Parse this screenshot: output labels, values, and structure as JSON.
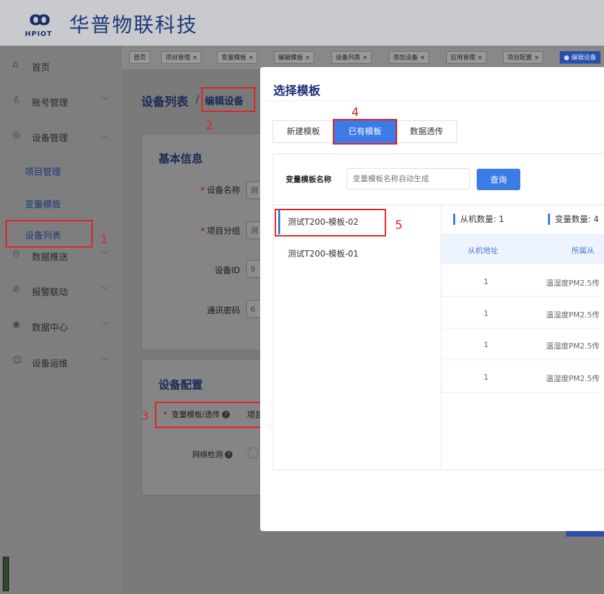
{
  "header": {
    "brand": "华普物联科技",
    "logo_text": "HPIOT"
  },
  "sidebar": {
    "items": [
      {
        "label": "首页",
        "icon": "home-icon",
        "glyph": "⌂"
      },
      {
        "label": "账号管理",
        "icon": "user-icon",
        "glyph": "♙"
      },
      {
        "label": "设备管理",
        "icon": "device-icon",
        "glyph": "◎"
      },
      {
        "label": "数据推送",
        "icon": "push-icon",
        "glyph": "⊙"
      },
      {
        "label": "报警联动",
        "icon": "alarm-icon",
        "glyph": "⊘"
      },
      {
        "label": "数据中心",
        "icon": "data-icon",
        "glyph": "◉"
      },
      {
        "label": "设备运维",
        "icon": "ops-icon",
        "glyph": "☺"
      }
    ],
    "sub_items": [
      "项目管理",
      "变量模板",
      "设备列表"
    ],
    "chevron_down": "﹀",
    "chevron_up": "︿"
  },
  "tabs": [
    {
      "label": "首页"
    },
    {
      "label": "项目管理 ×"
    },
    {
      "label": "变量模板 ×"
    },
    {
      "label": "编辑模板 ×"
    },
    {
      "label": "设备列表 ×"
    },
    {
      "label": "添加设备 ×"
    },
    {
      "label": "应用管理 ×"
    },
    {
      "label": "项目配置 ×"
    },
    {
      "label": "● 编辑设备"
    }
  ],
  "page": {
    "title": "设备列表",
    "breadcrumb_sep": "/",
    "breadcrumb_current": "编辑设备",
    "basic_info": {
      "title": "基本信息",
      "fields": [
        {
          "label": "设备名称",
          "required": true,
          "value": "测"
        },
        {
          "label": "项目分组",
          "required": true,
          "value": "测"
        },
        {
          "label": "设备ID",
          "required": false,
          "value": "9"
        },
        {
          "label": "通讯密码",
          "required": false,
          "value": "6"
        }
      ]
    },
    "device_config": {
      "title": "设备配置",
      "template_label": "变量模板/透传",
      "template_value": "项目",
      "network_label": "网络检测"
    }
  },
  "annotations": [
    "1",
    "2",
    "3",
    "4",
    "5"
  ],
  "modal": {
    "title": "选择模板",
    "segments": [
      "新建模板",
      "已有模板",
      "数据透传"
    ],
    "active_segment": "已有模板",
    "search": {
      "label": "变量模板名称",
      "placeholder": "变量模板名称自动生成",
      "button": "查询"
    },
    "templates": [
      "测试T200-模板-02",
      "测试T200-模板-01"
    ],
    "selected_template": "测试T200-模板-02",
    "stats": {
      "slave_count_label": "从机数量: 1",
      "var_count_label": "变量数量: 4"
    },
    "table": {
      "columns": [
        "从机地址",
        "所属从"
      ],
      "rows": [
        [
          "1",
          "温湿度PM2.5传"
        ],
        [
          "1",
          "温湿度PM2.5传"
        ],
        [
          "1",
          "温湿度PM2.5传"
        ],
        [
          "1",
          "温湿度PM2.5传"
        ]
      ]
    }
  }
}
